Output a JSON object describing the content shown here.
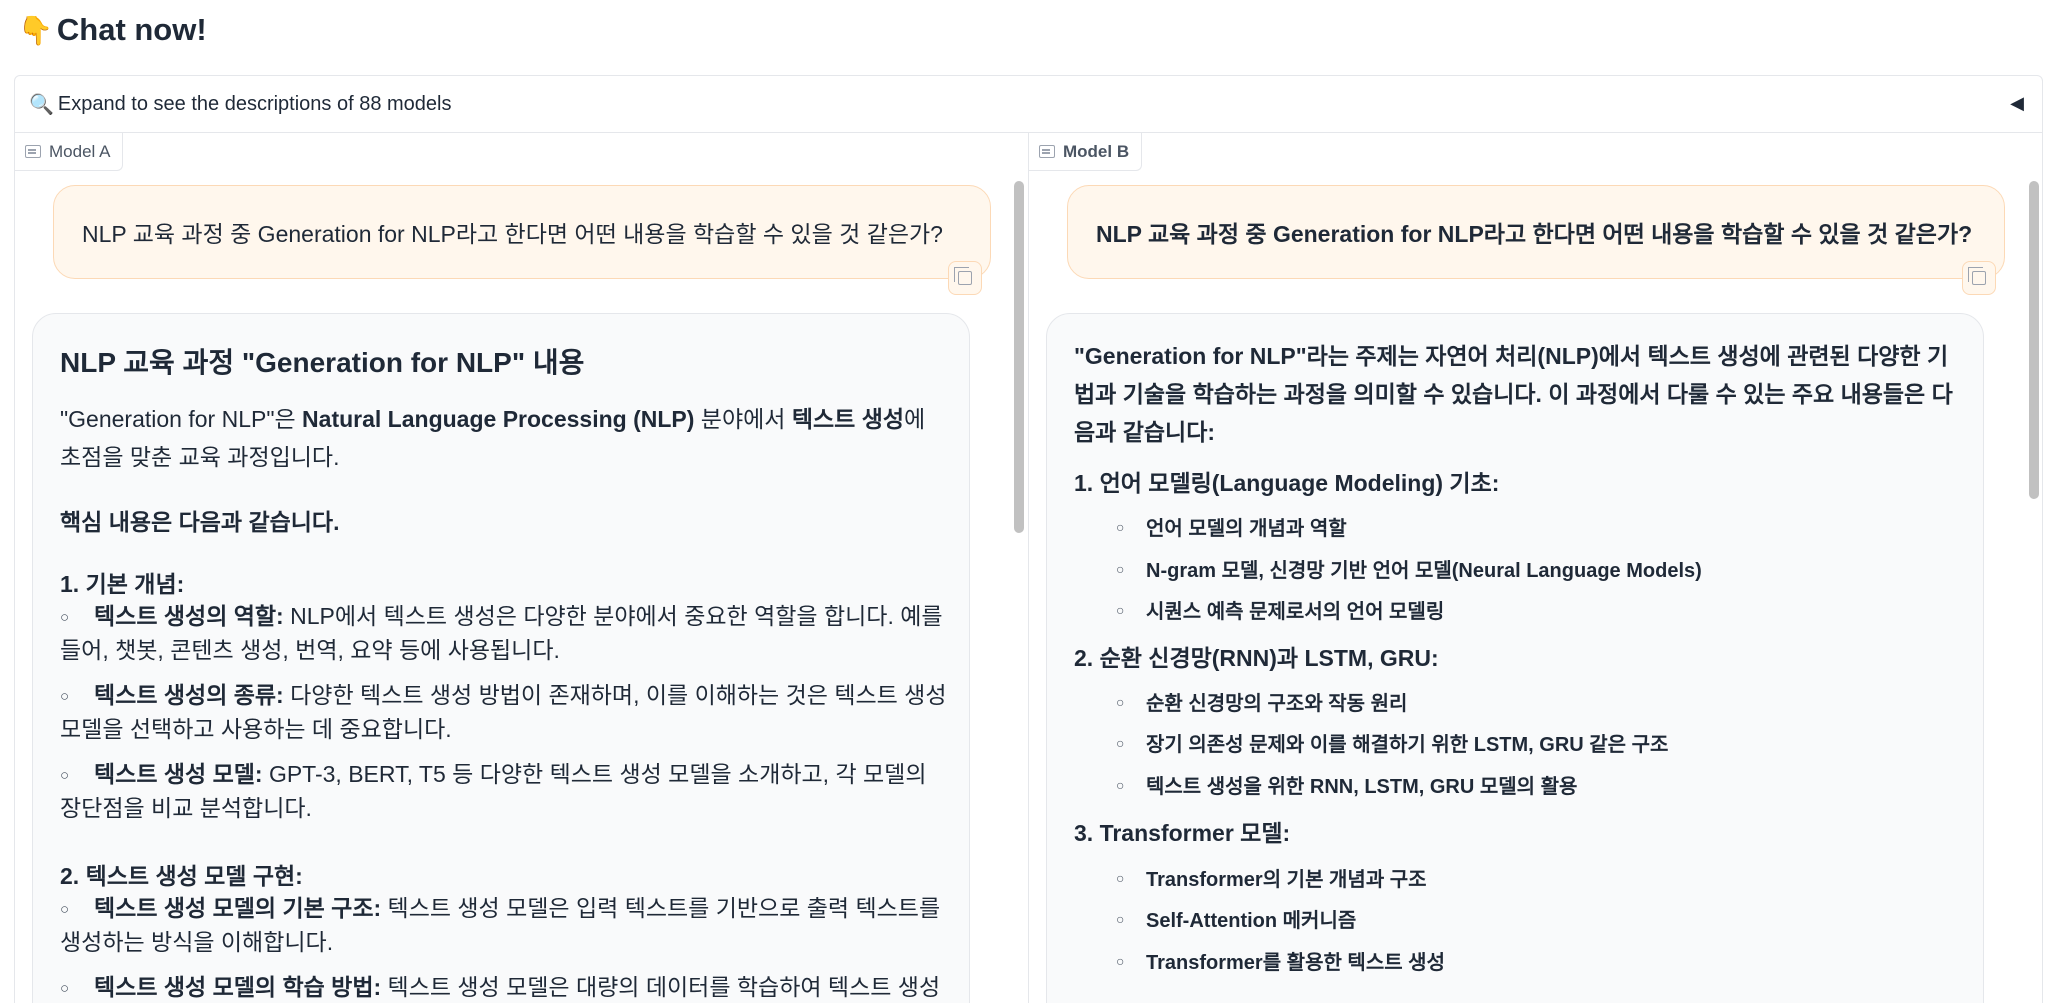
{
  "header": {
    "icon": "👇",
    "title": "Chat now!"
  },
  "accordion": {
    "icon": "🔍",
    "label": "Expand to see the descriptions of 88 models",
    "arrow": "◀"
  },
  "panel_a": {
    "label": "Model A",
    "user_message": "NLP 교육 과정 중 Generation for NLP라고 한다면 어떤 내용을 학습할 수 있을 것 같은가?",
    "response": {
      "heading": "NLP 교육 과정 \"Generation for NLP\" 내용",
      "intro_1": "\"Generation for NLP\"은 ",
      "intro_bold_1": "Natural Language Processing (NLP)",
      "intro_2": " 분야에서 ",
      "intro_bold_2": "텍스트 생성",
      "intro_3": "에 초점을 맞춘 교육 과정입니다.",
      "core": "핵심 내용은 다음과 같습니다.",
      "section_1": "1. 기본 개념:",
      "s1_items": [
        {
          "bold": "텍스트 생성의 역할:",
          "text": " NLP에서 텍스트 생성은 다양한 분야에서 중요한 역할을 합니다. 예를 들어, 챗봇, 콘텐츠 생성, 번역, 요약 등에 사용됩니다."
        },
        {
          "bold": "텍스트 생성의 종류:",
          "text": " 다양한 텍스트 생성 방법이 존재하며, 이를 이해하는 것은 텍스트 생성 모델을 선택하고 사용하는 데 중요합니다."
        },
        {
          "bold": "텍스트 생성 모델:",
          "text": " GPT-3, BERT, T5 등 다양한 텍스트 생성 모델을 소개하고, 각 모델의 장단점을 비교 분석합니다."
        }
      ],
      "section_2": "2. 텍스트 생성 모델 구현:",
      "s2_items": [
        {
          "bold": "텍스트 생성 모델의 기본 구조:",
          "text": " 텍스트 생성 모델은 입력 텍스트를 기반으로 출력 텍스트를 생성하는 방식을 이해합니다."
        },
        {
          "bold": "텍스트 생성 모델의 학습 방법:",
          "text": " 텍스트 생성 모델은 대량의 데이터를 학습하여 텍스트 생성 능"
        }
      ]
    }
  },
  "panel_b": {
    "label": "Model B",
    "user_message": "NLP 교육 과정 중 Generation for NLP라고 한다면 어떤 내용을 학습할 수 있을 것 같은가?",
    "response": {
      "intro": "\"Generation for NLP\"라는 주제는 자연어 처리(NLP)에서 텍스트 생성에 관련된 다양한 기법과 기술을 학습하는 과정을 의미할 수 있습니다. 이 과정에서 다룰 수 있는 주요 내용들은 다음과 같습니다:",
      "sections": [
        {
          "num": "1.",
          "title": "언어 모델링(Language Modeling) 기초:",
          "items": [
            "언어 모델의 개념과 역할",
            "N-gram 모델, 신경망 기반 언어 모델(Neural Language Models)",
            "시퀀스 예측 문제로서의 언어 모델링"
          ]
        },
        {
          "num": "2.",
          "title": "순환 신경망(RNN)과 LSTM, GRU:",
          "items": [
            "순환 신경망의 구조와 작동 원리",
            "장기 의존성 문제와 이를 해결하기 위한 LSTM, GRU 같은 구조",
            "텍스트 생성을 위한 RNN, LSTM, GRU 모델의 활용"
          ]
        },
        {
          "num": "3.",
          "title": "Transformer 모델:",
          "items": [
            "Transformer의 기본 개념과 구조",
            "Self-Attention 메커니즘",
            "Transformer를 활용한 텍스트 생성"
          ]
        }
      ]
    }
  },
  "bullet_glyph": "○",
  "colors": {
    "user_bg": "#fff7ed",
    "user_border": "#fcd9b6",
    "bot_bg": "#f9fafb",
    "border": "#e5e7eb"
  }
}
